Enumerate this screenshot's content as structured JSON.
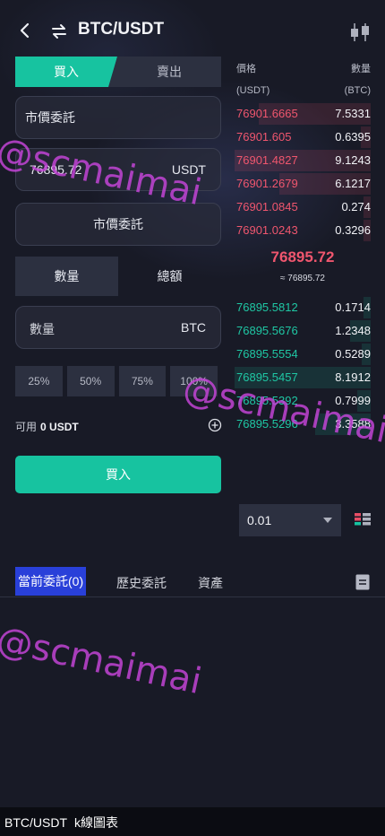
{
  "header": {
    "pair": "BTC/USDT"
  },
  "trade_tabs": {
    "buy": "買入",
    "sell": "賣出"
  },
  "order_type": "市價委託",
  "price_field": {
    "value": "76895.72",
    "unit": "USDT"
  },
  "market_button": "市價委託",
  "mode_tabs": {
    "quantity": "數量",
    "total": "總額"
  },
  "amount_field": {
    "placeholder": "數量",
    "unit": "BTC"
  },
  "percent_buttons": [
    "25%",
    "50%",
    "75%",
    "100%"
  ],
  "available": {
    "label": "可用",
    "value": "0 USDT"
  },
  "submit_label": "買入",
  "orderbook": {
    "price_header": "價格",
    "qty_header": "數量",
    "price_unit": "(USDT)",
    "qty_unit": "(BTC)",
    "asks": [
      {
        "price": "76901.6665",
        "qty": "7.5331"
      },
      {
        "price": "76901.605",
        "qty": "0.6395"
      },
      {
        "price": "76901.4827",
        "qty": "9.1243"
      },
      {
        "price": "76901.2679",
        "qty": "6.1217"
      },
      {
        "price": "76901.0845",
        "qty": "0.274"
      },
      {
        "price": "76901.0243",
        "qty": "0.3296"
      }
    ],
    "last_price": "76895.72",
    "last_price_sub": "≈ 76895.72",
    "bids": [
      {
        "price": "76895.5812",
        "qty": "0.1714"
      },
      {
        "price": "76895.5676",
        "qty": "1.2348"
      },
      {
        "price": "76895.5554",
        "qty": "0.5289"
      },
      {
        "price": "76895.5457",
        "qty": "8.1912"
      },
      {
        "price": "76895.5392",
        "qty": "0.7999"
      },
      {
        "price": "76895.5296",
        "qty": "3.3588"
      }
    ],
    "depth": "0.01"
  },
  "order_tabs": {
    "current": "當前委託(0)",
    "history": "歷史委託",
    "assets": "資產"
  },
  "footer": {
    "pair": "BTC/USDT",
    "chart": "k線圖表"
  },
  "watermark": "@scmaimai",
  "colors": {
    "buy": "#17c3a0",
    "ask": "#f0566e",
    "bid": "#1fc7a4",
    "active_tab": "#2940d9"
  }
}
